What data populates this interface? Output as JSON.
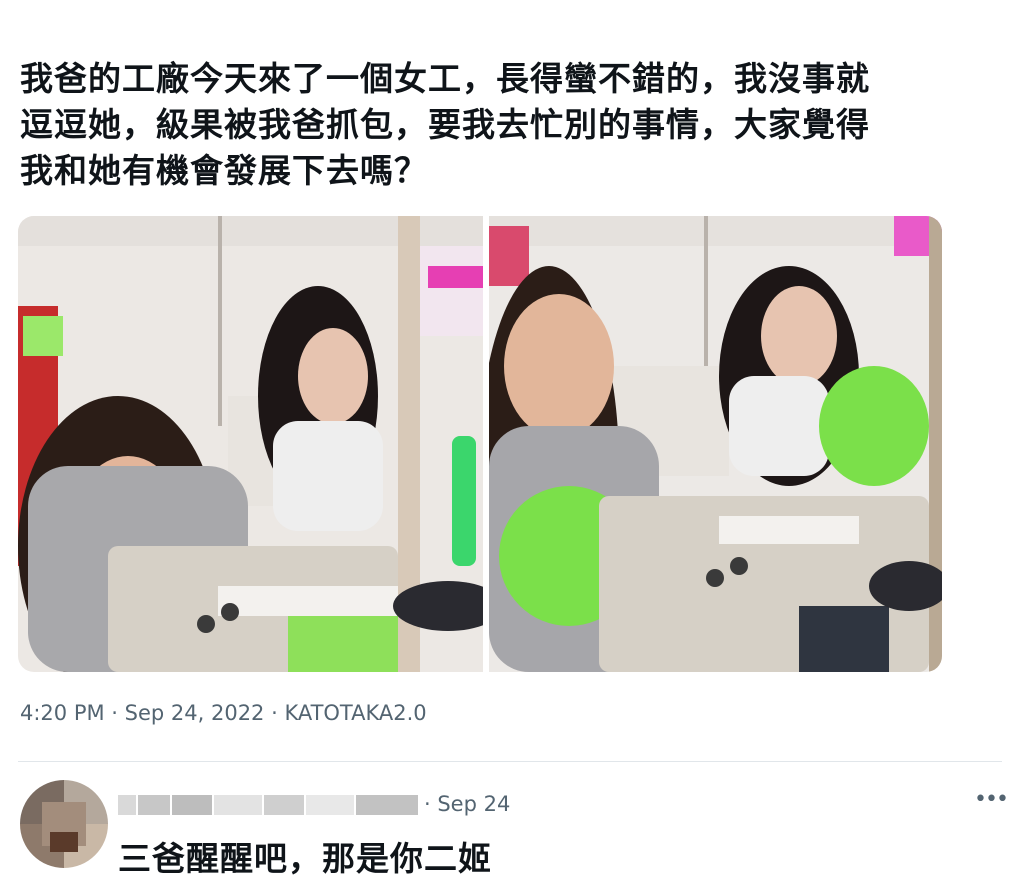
{
  "tweet": {
    "text_lines": [
      "我爸的工廠今天來了一個女工，長得蠻不錯的，我沒事就",
      "逗逗她，級果被我爸抓包，要我去忙別的事情，大家覺得",
      "我和她有機會發展下去嗎？"
    ],
    "meta": "4:20 PM · Sep 24, 2022 · KATOTAKA2.0"
  },
  "media": {
    "photos": [
      "factory-photo-left",
      "factory-photo-right"
    ]
  },
  "reply": {
    "date": "· Sep 24",
    "more_icon": "more-horizontal-icon",
    "more_glyph": "•••",
    "text_partial": "三爸醒醒吧，那是你二姬"
  },
  "colors": {
    "text": "#0f1419",
    "secondary": "#536471",
    "divider": "#e1e6ea",
    "fabric_green": "#7ee04a"
  }
}
